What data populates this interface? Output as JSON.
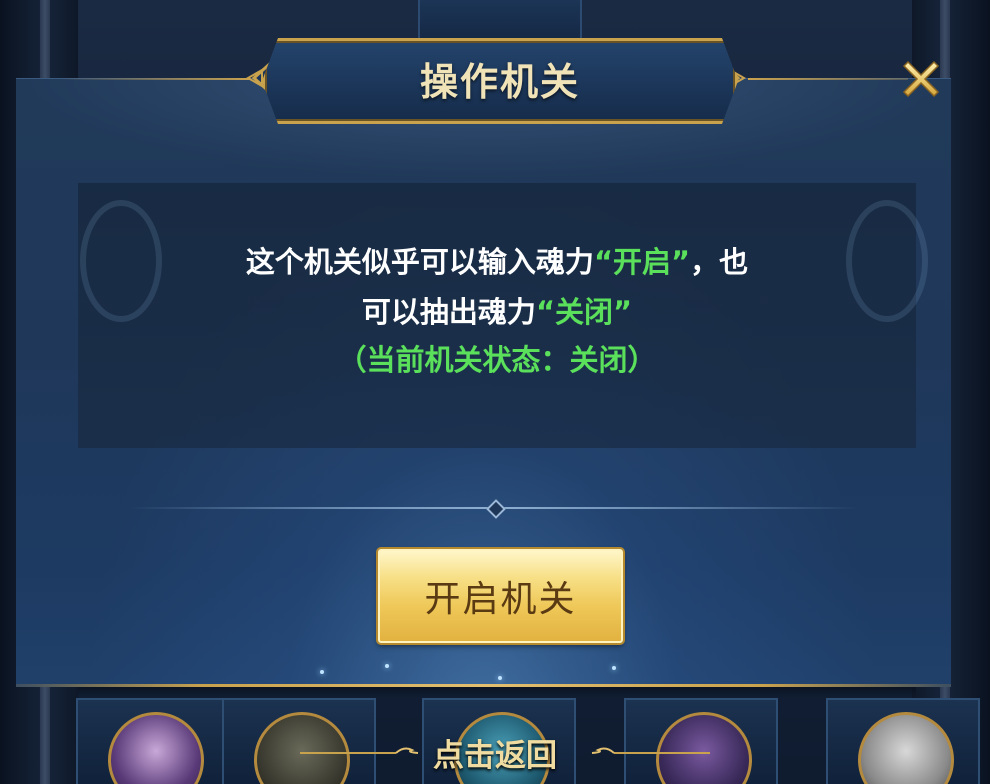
{
  "dialog": {
    "title": "操作机关",
    "message": {
      "line1_prefix": "这个机关似乎可以输入魂力",
      "line1_highlight": "“开启”",
      "line1_suffix": "，也",
      "line2_prefix": "可以抽出魂力",
      "line2_highlight": "“关闭”",
      "line3_status": "（当前机关状态：关闭）"
    },
    "open_button_label": "开启机关",
    "close_icon": "close-x-icon"
  },
  "footer": {
    "back_label": "点击返回"
  },
  "colors": {
    "gold": "#c9a24e",
    "highlight_green": "#5be05b",
    "panel_blue": "#1f385a",
    "button_gold": "#efc95a"
  }
}
